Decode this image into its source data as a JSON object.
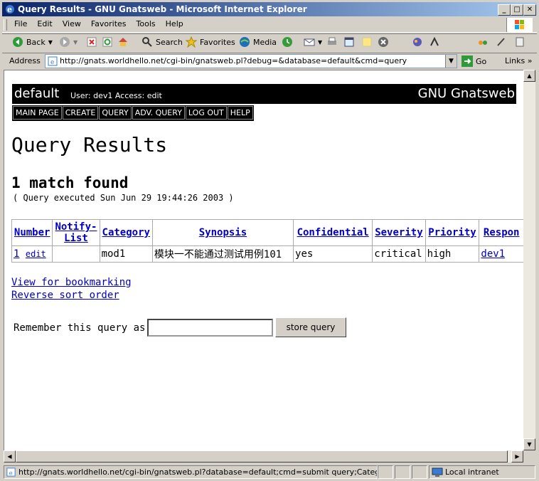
{
  "window": {
    "title": "Query Results - GNU Gnatsweb - Microsoft Internet Explorer"
  },
  "menu": [
    "File",
    "Edit",
    "View",
    "Favorites",
    "Tools",
    "Help"
  ],
  "toolbar": {
    "back": "Back",
    "search": "Search",
    "favorites": "Favorites",
    "media": "Media"
  },
  "address": {
    "label": "Address",
    "url": "http://gnats.worldhello.net/cgi-bin/gnatsweb.pl?debug=&database=default&cmd=query",
    "go": "Go",
    "links": "Links"
  },
  "page": {
    "database": "default",
    "user_line": "User: dev1  Access: edit",
    "brand": "GNU Gnatsweb",
    "nav": [
      "MAIN PAGE",
      "CREATE",
      "QUERY",
      "ADV. QUERY",
      "LOG OUT",
      "HELP"
    ],
    "title": "Query Results",
    "match": "1 match found",
    "executed": "( Query executed Sun Jun 29 19:44:26 2003 )",
    "columns": [
      "Number",
      "Notify-List",
      "Category",
      "Synopsis",
      "Confidential",
      "Severity",
      "Priority",
      "Respon"
    ],
    "rows": [
      {
        "number": "1",
        "edit": "edit",
        "notify": "",
        "category": "mod1",
        "synopsis": "模块一不能通过测试用例101",
        "confidential": "yes",
        "severity": "critical",
        "priority": "high",
        "responsible": "dev1"
      }
    ],
    "view_bookmark": "View for bookmarking",
    "reverse_sort": "Reverse sort order",
    "remember_label": "Remember this query as:",
    "store_button": "store query"
  },
  "status": {
    "url": "http://gnats.worldhello.net/cgi-bin/gnatsweb.pl?database=default;cmd=submit query;Category=any;Co",
    "zone": "Local intranet"
  }
}
